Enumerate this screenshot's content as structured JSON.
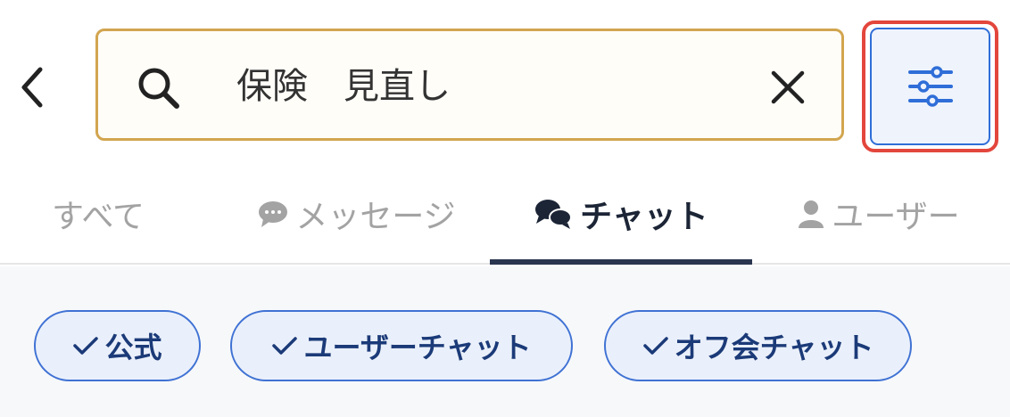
{
  "search": {
    "query": "保険　見直し"
  },
  "tabs": [
    {
      "label": "すべて",
      "icon": ""
    },
    {
      "label": "メッセージ",
      "icon": "speech-bubble-icon"
    },
    {
      "label": "チャット",
      "icon": "chat-bubbles-icon"
    },
    {
      "label": "ユーザー",
      "icon": "person-icon"
    }
  ],
  "active_tab": "チャット",
  "filter_chips": [
    {
      "label": "公式",
      "checked": true
    },
    {
      "label": "ユーザーチャット",
      "checked": true
    },
    {
      "label": "オフ会チャット",
      "checked": true
    }
  ],
  "colors": {
    "accent": "#2f6ed8",
    "search_border": "#d2a54f",
    "highlight_border": "#e3463c",
    "active_tab": "#1c2536"
  }
}
